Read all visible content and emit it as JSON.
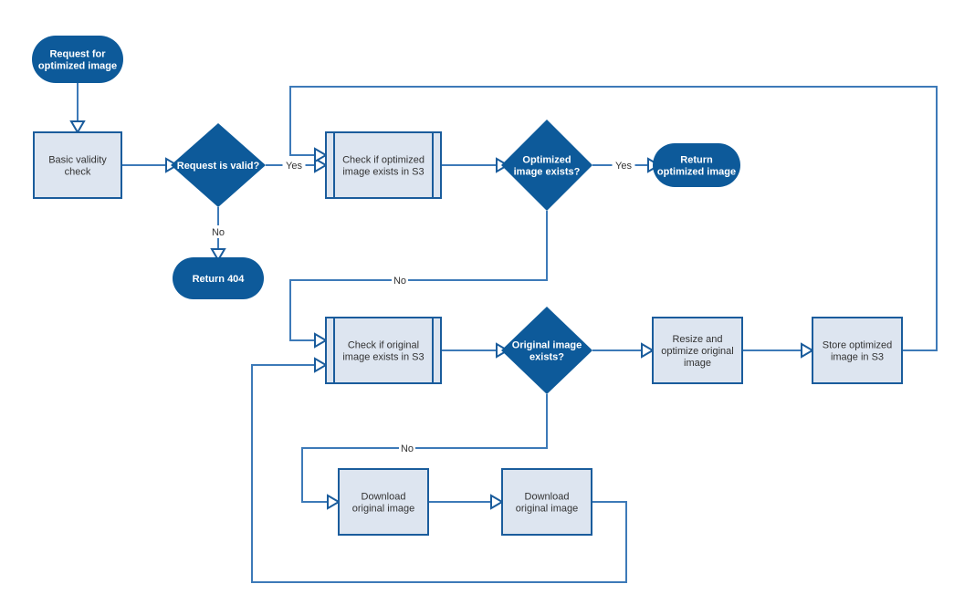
{
  "colors": {
    "dark_fill": "#0d5a9a",
    "process_fill": "#dde5f0",
    "stroke": "#1a5c9c",
    "line": "#3d7ab8"
  },
  "nodes": {
    "start": {
      "lines": [
        "Request for",
        "optimized image"
      ],
      "type": "terminal"
    },
    "validity": {
      "lines": [
        "Basic validity",
        "check"
      ],
      "type": "process"
    },
    "valid_decision": {
      "lines": [
        "Request is valid?"
      ],
      "type": "decision"
    },
    "return404": {
      "lines": [
        "Return 404"
      ],
      "type": "terminal"
    },
    "check_optimized": {
      "lines": [
        "Check if optimized",
        "image exists in S3"
      ],
      "type": "subprocess"
    },
    "optimized_decision": {
      "lines": [
        "Optimized",
        "image exists?"
      ],
      "type": "decision"
    },
    "return_optimized": {
      "lines": [
        "Return",
        "optimized image"
      ],
      "type": "terminal"
    },
    "check_original": {
      "lines": [
        "Check if original",
        "image exists in S3"
      ],
      "type": "subprocess"
    },
    "original_decision": {
      "lines": [
        "Original image",
        "exists?"
      ],
      "type": "decision"
    },
    "resize": {
      "lines": [
        "Resize and",
        "optimize original",
        "image"
      ],
      "type": "process"
    },
    "store": {
      "lines": [
        "Store optimized",
        "image in S3"
      ],
      "type": "process"
    },
    "download1": {
      "lines": [
        "Download",
        "original image"
      ],
      "type": "process"
    },
    "download2": {
      "lines": [
        "Download",
        "original image"
      ],
      "type": "process"
    }
  },
  "edge_labels": {
    "valid_yes": "Yes",
    "valid_no": "No",
    "optimized_yes": "Yes",
    "optimized_no": "No",
    "original_no": "No"
  }
}
